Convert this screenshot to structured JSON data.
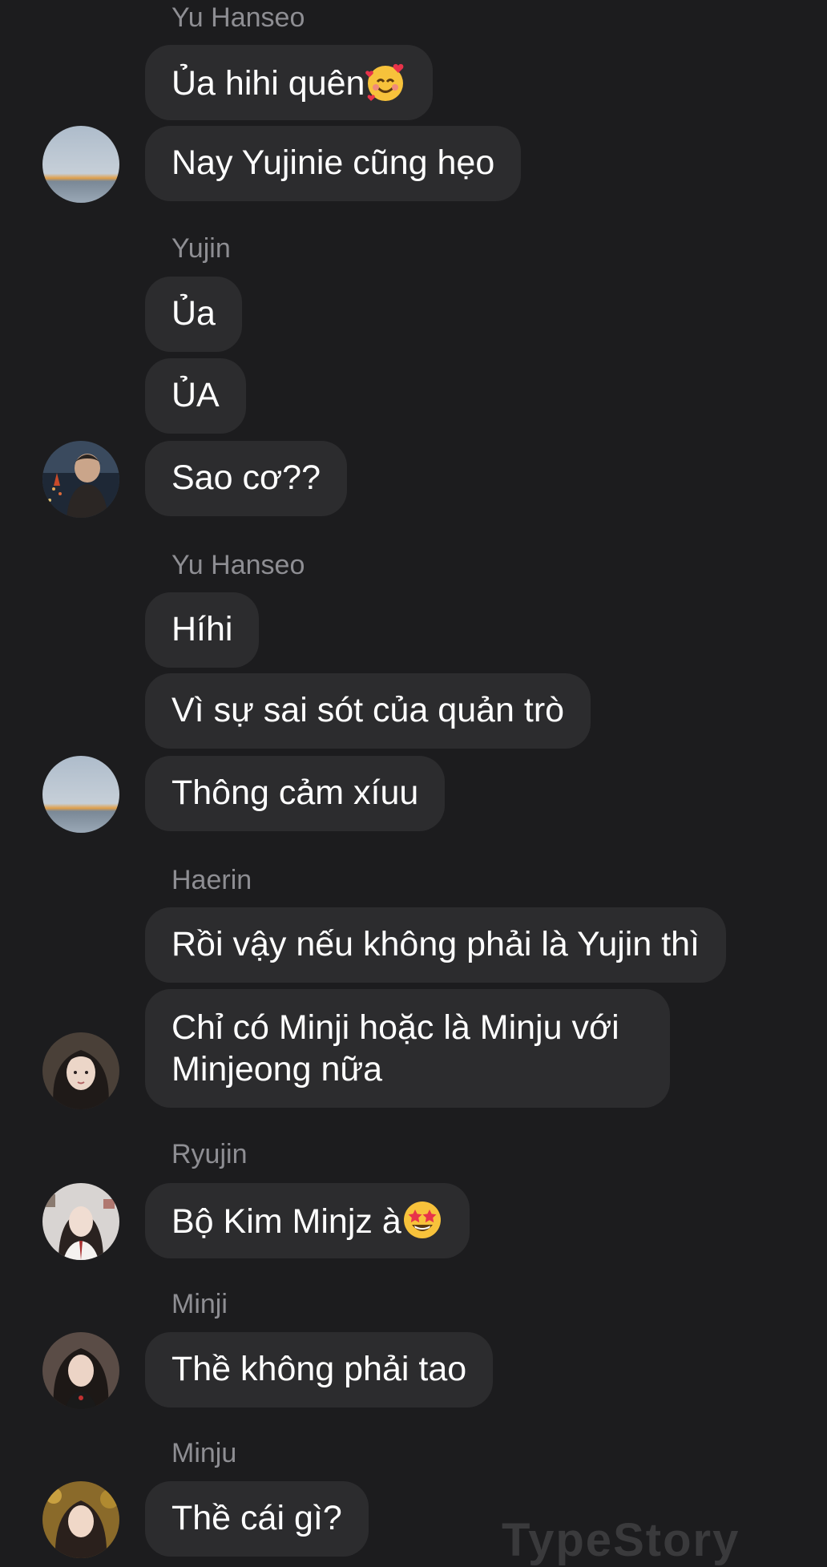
{
  "conversation": {
    "groups": [
      {
        "sender": "Yu Hanseo",
        "messages": [
          "Ủa hihi quên",
          "Nay Yujinie cũng hẹo"
        ],
        "emojis": [
          "smiling-face-with-hearts"
        ]
      },
      {
        "sender": "Yujin",
        "messages": [
          "Ủa",
          "ỦA",
          "Sao cơ??"
        ]
      },
      {
        "sender": "Yu Hanseo",
        "messages": [
          "Híhi",
          "Vì sự sai sót của quản trò",
          "Thông cảm xíuu"
        ]
      },
      {
        "sender": "Haerin",
        "messages": [
          "Rồi vậy nếu không phải là Yujin thì",
          "Chỉ có Minji hoặc là Minju với Minjeong nữa"
        ]
      },
      {
        "sender": "Ryujin",
        "messages": [
          "Bộ Kim Minjz à"
        ],
        "emojis": [
          "star-struck"
        ]
      },
      {
        "sender": "Minji",
        "messages": [
          "Thề không phải tao"
        ]
      },
      {
        "sender": "Minju",
        "messages": [
          "Thề cái gì?"
        ]
      }
    ]
  },
  "watermark": "TypeStory",
  "colors": {
    "background": "#1c1c1e",
    "bubble": "#2c2c2e",
    "sender_name": "#8e8e93",
    "text": "#ffffff"
  }
}
